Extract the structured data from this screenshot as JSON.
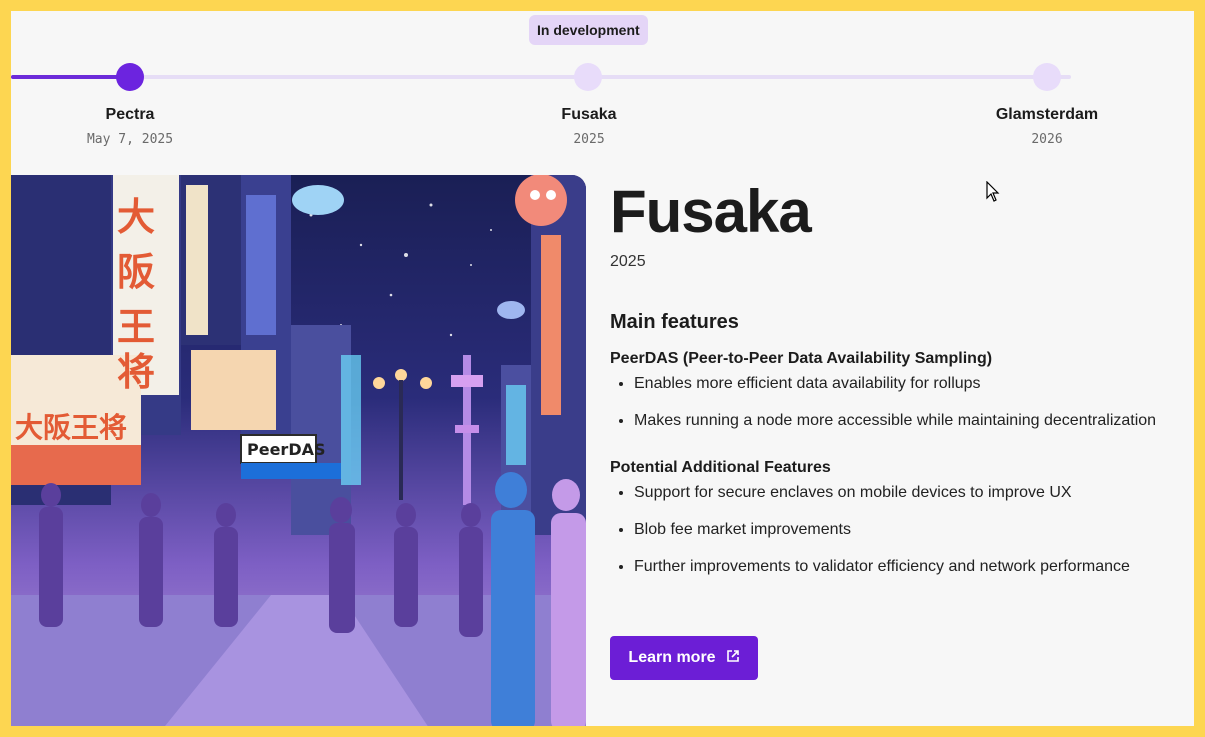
{
  "timeline": {
    "badge": "In development",
    "stages": [
      {
        "name": "Pectra",
        "date": "May 7, 2025"
      },
      {
        "name": "Fusaka",
        "date": "2025"
      },
      {
        "name": "Glamsterdam",
        "date": "2026"
      }
    ]
  },
  "illustration": {
    "sign_peerdas": "PeerDAS",
    "sign_kanji": "大阪王将"
  },
  "upgrade": {
    "title": "Fusaka",
    "year": "2025",
    "main_features_heading": "Main features",
    "groups": [
      {
        "heading": "PeerDAS (Peer-to-Peer Data Availability Sampling)",
        "items": [
          "Enables more efficient data availability for rollups",
          "Makes running a node more accessible while maintaining decentralization"
        ]
      },
      {
        "heading": "Potential Additional Features",
        "items": [
          "Support for secure enclaves on mobile devices to improve UX",
          "Blob fee market improvements",
          "Further improvements to validator efficiency and network performance"
        ]
      }
    ],
    "learn_more": "Learn more"
  },
  "colors": {
    "accent": "#6c1ed6",
    "border": "#fdd651"
  },
  "icons": {
    "external_link": "external-link-icon",
    "cursor": "mouse-pointer-icon"
  }
}
